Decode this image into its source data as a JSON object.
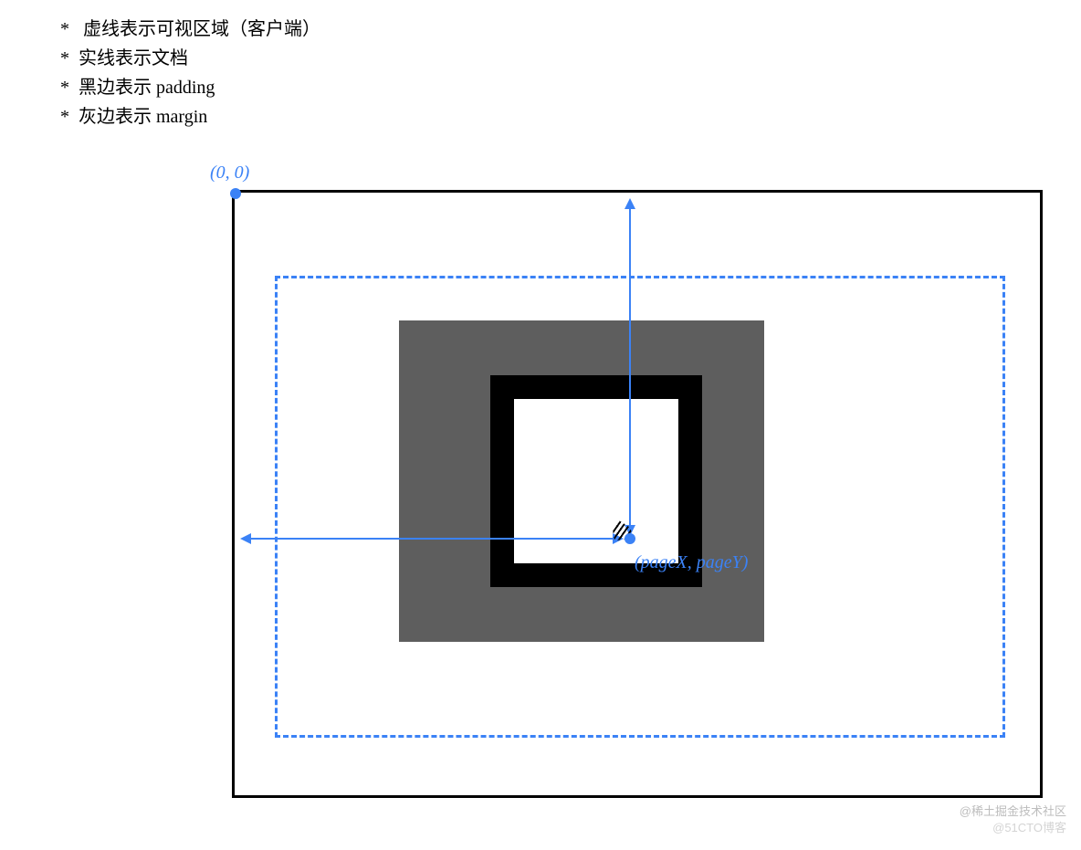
{
  "legend": {
    "items": [
      "*   虚线表示可视区域（客户端）",
      "*  实线表示文档",
      "*  黑边表示 padding",
      "*  灰边表示 margin"
    ]
  },
  "diagram": {
    "origin_label": "(0, 0)",
    "coord_label": "(pageX, pageY)"
  },
  "colors": {
    "accent": "#3b82f6",
    "margin_fill": "#5e5e5e",
    "padding_fill": "#000000",
    "document_border": "#000000"
  },
  "watermarks": {
    "line1": "@稀土掘金技术社区",
    "line2": "@51CTO博客"
  }
}
